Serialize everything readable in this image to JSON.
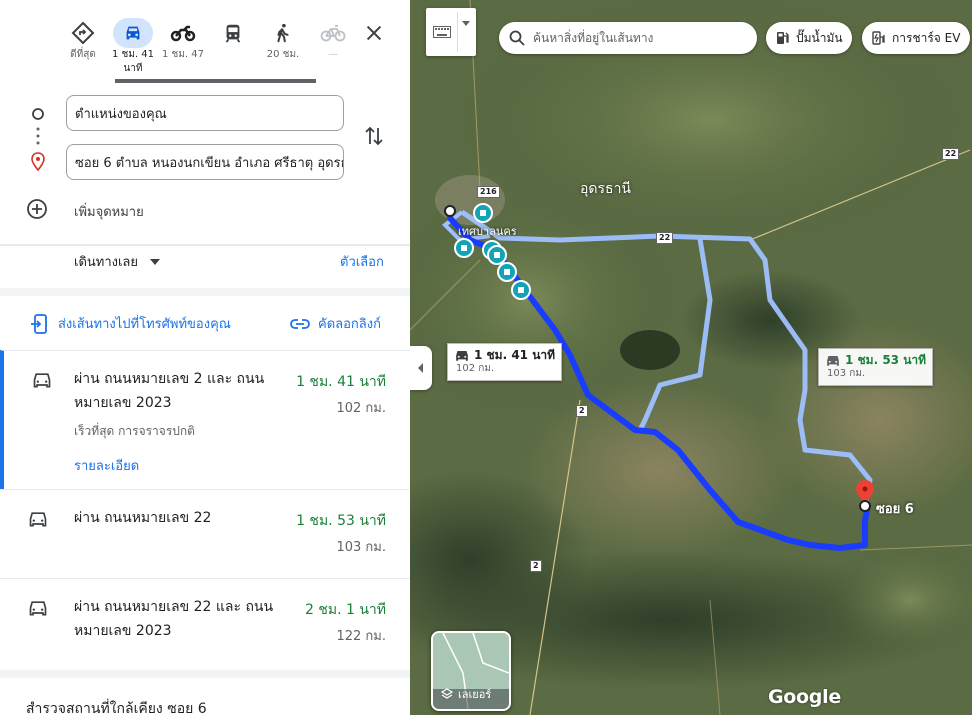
{
  "travel_modes": [
    {
      "name": "best",
      "label": "ดีที่สุด"
    },
    {
      "name": "driving",
      "label": "1 ชม. 41 นาที"
    },
    {
      "name": "motorcycle",
      "label": "1 ชม. 47"
    },
    {
      "name": "transit",
      "label": ""
    },
    {
      "name": "walking",
      "label": "20 ชม."
    },
    {
      "name": "cycling",
      "label": "—"
    }
  ],
  "waypoints": {
    "origin": "ตำแหน่งของคุณ",
    "destination": "ซอย 6 ตำบล หนองนกเขียน อำเภอ ศรีธาตุ อุดรธ",
    "add_destination": "เพิ่มจุดหมาย"
  },
  "leave_now": "เดินทางเลย",
  "options": "ตัวเลือก",
  "send_to_phone": "ส่งเส้นทางไปที่โทรศัพท์ของคุณ",
  "copy_link": "คัดลอกลิงก์",
  "routes": [
    {
      "title": "ผ่าน ถนนหมายเลข 2 และ ถนนหมายเลข 2023",
      "time": "1 ชม. 41 นาที",
      "distance": "102 กม.",
      "subtitle": "เร็วที่สุด การจราจรปกติ",
      "details": "รายละเอียด"
    },
    {
      "title": "ผ่าน ถนนหมายเลข 22",
      "time": "1 ชม. 53 นาที",
      "distance": "103 กม."
    },
    {
      "title": "ผ่าน ถนนหมายเลข 22 และ ถนนหมายเลข 2023",
      "time": "2 ชม. 1 นาที",
      "distance": "122 กม."
    }
  ],
  "explore_nearby": "สำรวจสถานที่ใกล้เคียง ซอย 6",
  "map": {
    "search_placeholder": "ค้นหาสิ่งที่อยู่ในเส้นทาง",
    "gas_label": "ปั๊มน้ำมัน",
    "ev_label": "การชาร์จ EV",
    "province_label": "อุดรธานี",
    "city_label": "เทศบาลนคร",
    "dest_label": "ซอย 6",
    "callout_primary": {
      "time": "1 ชม. 41 นาที",
      "distance": "102 กม."
    },
    "callout_alt": {
      "time": "1 ชม. 53 นาที",
      "distance": "103 กม."
    },
    "layers_label": "เลเยอร์",
    "logo": "Google",
    "road_shields": [
      "216",
      "22",
      "22",
      "2",
      "2"
    ]
  },
  "colors": {
    "accent": "#1a73e8",
    "route": "#1f4fff",
    "time_green": "#188038"
  }
}
